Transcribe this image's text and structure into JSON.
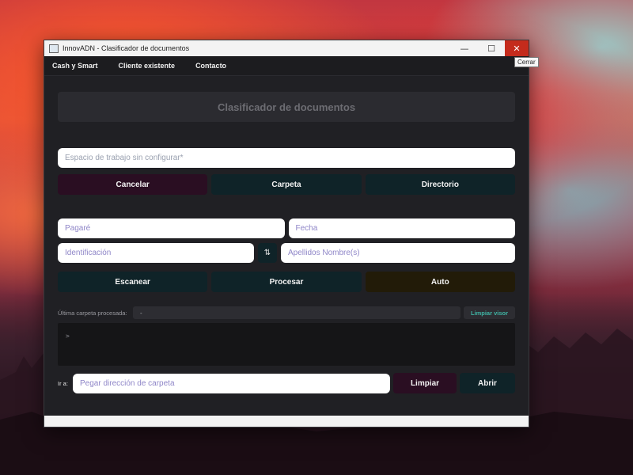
{
  "window": {
    "title": "InnovADN - Clasificador de documentos",
    "minimize_glyph": "—",
    "maximize_glyph": "☐",
    "close_glyph": "✕",
    "close_tooltip": "Cerrar"
  },
  "menu": {
    "items": [
      "Cash y Smart",
      "Cliente existente",
      "Contacto"
    ]
  },
  "header": {
    "title": "Clasificador de documentos"
  },
  "workspace": {
    "placeholder": "Espacio de trabajo sin configurar*",
    "buttons": {
      "cancel": "Cancelar",
      "folder": "Carpeta",
      "directory": "Directorio"
    }
  },
  "form": {
    "pagare_placeholder": "Pagaré",
    "fecha_placeholder": "Fecha",
    "identificacion_placeholder": "Identificación",
    "swap_glyph": "⇅",
    "nombre_placeholder": "Apellidos Nombre(s)"
  },
  "actions": {
    "scan": "Escanear",
    "process": "Procesar",
    "auto": "Auto"
  },
  "status": {
    "label": "Última carpeta procesada:",
    "value": "-",
    "clear_viewer": "Limpiar visor"
  },
  "console": {
    "prompt": ">"
  },
  "goto": {
    "label": "Ir a:",
    "placeholder": "Pegar dirección de carpeta",
    "clear": "Limpiar",
    "open": "Abrir"
  },
  "colors": {
    "teal_button": "#0f2328",
    "maroon_button": "#2a0e22",
    "olive_button": "#221b08",
    "accent_text": "#3fb3a3",
    "close_red": "#c42b1c"
  }
}
